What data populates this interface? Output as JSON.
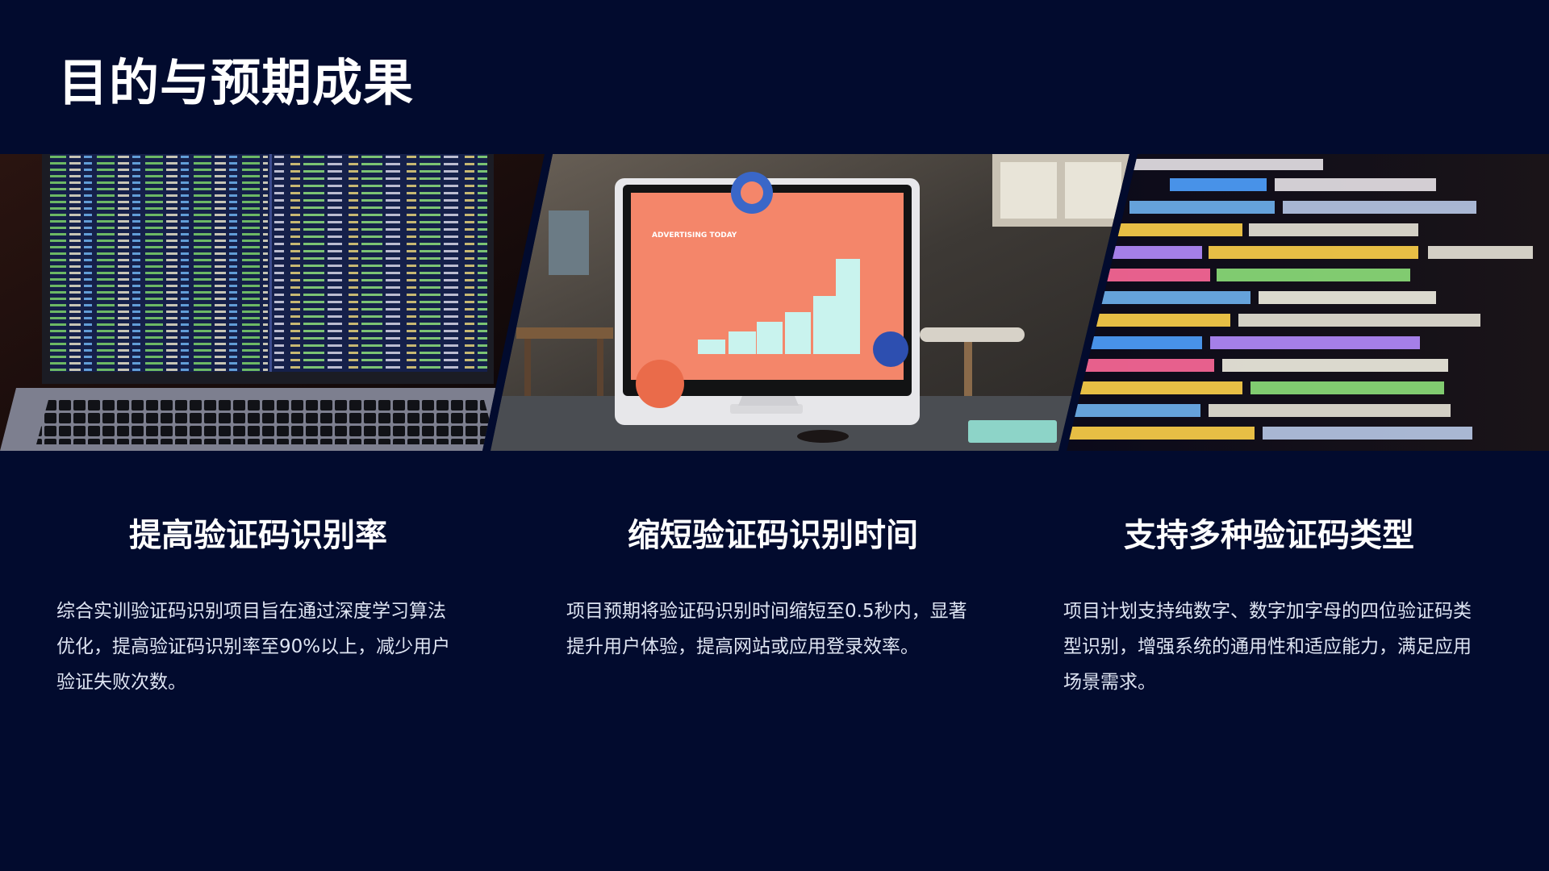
{
  "slide": {
    "title": "目的与预期成果"
  },
  "images": [
    {
      "name": "laptop-code-photo"
    },
    {
      "name": "desktop-monitor-bar-chart-photo",
      "screen_heading": "ADVERTISING TODAY"
    },
    {
      "name": "code-closeup-photo"
    }
  ],
  "goals": [
    {
      "heading": "提高验证码识别率",
      "body": "综合实训验证码识别项目旨在通过深度学习算法优化，提高验证码识别率至90%以上，减少用户验证失败次数。"
    },
    {
      "heading": "缩短验证码识别时间",
      "body": "项目预期将验证码识别时间缩短至0.5秒内，显著提升用户体验，提高网站或应用登录效率。"
    },
    {
      "heading": "支持多种验证码类型",
      "body": "项目计划支持纯数字、数字加字母的四位验证码类型识别，增强系统的通用性和适应能力，满足应用场景需求。"
    }
  ],
  "colors": {
    "background": "#020b2e",
    "title": "#ffffff",
    "body_text": "#dfe5f3",
    "monitor_screen": "#f4866a",
    "chart_bars": "#c9f3ee"
  }
}
